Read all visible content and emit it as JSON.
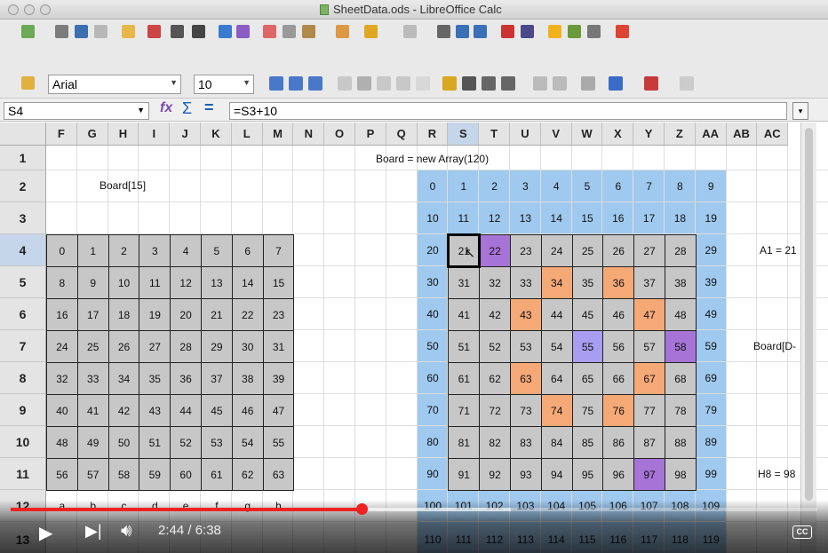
{
  "window": {
    "title": "SheetData.ods - LibreOffice Calc"
  },
  "font_bar": {
    "font_name": "Arial",
    "font_size": "10"
  },
  "formula_bar": {
    "name_box": "S4",
    "formula": "=S3+10"
  },
  "columns": [
    "F",
    "G",
    "H",
    "I",
    "J",
    "K",
    "L",
    "M",
    "N",
    "O",
    "P",
    "Q",
    "R",
    "S",
    "T",
    "U",
    "V",
    "W",
    "X",
    "Y",
    "Z",
    "AA",
    "AB",
    "AC"
  ],
  "rows": [
    "1",
    "2",
    "3",
    "4",
    "5",
    "6",
    "7",
    "8",
    "9",
    "10",
    "11",
    "12",
    "13"
  ],
  "active_cell": "S4",
  "sheet_text": {
    "board_decl": "Board = new Array(120)",
    "board15": "Board[15]",
    "a1": "A1 = 21",
    "boardd": "Board[D-",
    "h8": "H8 = 98"
  },
  "left_board": [
    [
      "0",
      "1",
      "2",
      "3",
      "4",
      "5",
      "6",
      "7"
    ],
    [
      "8",
      "9",
      "10",
      "11",
      "12",
      "13",
      "14",
      "15"
    ],
    [
      "16",
      "17",
      "18",
      "19",
      "20",
      "21",
      "22",
      "23"
    ],
    [
      "24",
      "25",
      "26",
      "27",
      "28",
      "29",
      "30",
      "31"
    ],
    [
      "32",
      "33",
      "34",
      "35",
      "36",
      "37",
      "38",
      "39"
    ],
    [
      "40",
      "41",
      "42",
      "43",
      "44",
      "45",
      "46",
      "47"
    ],
    [
      "48",
      "49",
      "50",
      "51",
      "52",
      "53",
      "54",
      "55"
    ],
    [
      "56",
      "57",
      "58",
      "59",
      "60",
      "61",
      "62",
      "63"
    ],
    [
      "a",
      "b",
      "c",
      "d",
      "e",
      "f",
      "g",
      "h"
    ]
  ],
  "right_board": [
    [
      "0",
      "1",
      "2",
      "3",
      "4",
      "5",
      "6",
      "7",
      "8",
      "9"
    ],
    [
      "10",
      "11",
      "12",
      "13",
      "14",
      "15",
      "16",
      "17",
      "18",
      "19"
    ],
    [
      "20",
      "21",
      "22",
      "23",
      "24",
      "25",
      "26",
      "27",
      "28",
      "29"
    ],
    [
      "30",
      "31",
      "32",
      "33",
      "34",
      "35",
      "36",
      "37",
      "38",
      "39"
    ],
    [
      "40",
      "41",
      "42",
      "43",
      "44",
      "45",
      "46",
      "47",
      "48",
      "49"
    ],
    [
      "50",
      "51",
      "52",
      "53",
      "54",
      "55",
      "56",
      "57",
      "58",
      "59"
    ],
    [
      "60",
      "61",
      "62",
      "63",
      "64",
      "65",
      "66",
      "67",
      "68",
      "69"
    ],
    [
      "70",
      "71",
      "72",
      "73",
      "74",
      "75",
      "76",
      "77",
      "78",
      "79"
    ],
    [
      "80",
      "81",
      "82",
      "83",
      "84",
      "85",
      "86",
      "87",
      "88",
      "89"
    ],
    [
      "90",
      "91",
      "92",
      "93",
      "94",
      "95",
      "96",
      "97",
      "98",
      "99"
    ],
    [
      "100",
      "101",
      "102",
      "103",
      "104",
      "105",
      "106",
      "107",
      "108",
      "109"
    ],
    [
      "110",
      "111",
      "112",
      "113",
      "114",
      "115",
      "116",
      "117",
      "118",
      "119"
    ]
  ],
  "highlight_colors": {
    "gray": "#c7c7c7",
    "orange": "#f5a977",
    "purple": "#a673d6",
    "lavender": "#a99df2",
    "blue_band": "#9fc9ee"
  },
  "cell_highlights": {
    "22": "purple",
    "34": "orange",
    "36": "orange",
    "43": "orange",
    "47": "orange",
    "55": "lavender",
    "58": "purple",
    "63": "orange",
    "67": "orange",
    "74": "orange",
    "76": "orange",
    "97": "purple"
  },
  "player": {
    "time": "2:44 / 6:38",
    "progress": 0.435,
    "buffered": 0.62,
    "cc_label": "CC"
  }
}
